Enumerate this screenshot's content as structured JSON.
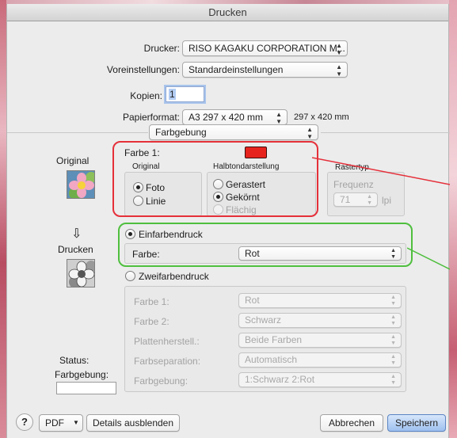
{
  "window": {
    "title": "Drucken"
  },
  "printer": {
    "label": "Drucker:",
    "value": "RISO KAGAKU CORPORATION M..."
  },
  "presets": {
    "label": "Voreinstellungen:",
    "value": "Standardeinstellungen"
  },
  "copies": {
    "label": "Kopien:",
    "value": "1"
  },
  "paper": {
    "label": "Papierformat:",
    "value": "A3 297 x 420 mm",
    "size_text": "297 x 420 mm"
  },
  "section": {
    "value": "Farbgebung"
  },
  "original": {
    "heading": "Original",
    "color1_label": "Farbe 1:",
    "color1_swatch": "#e6241d",
    "group_label": "Original",
    "options": [
      "Foto",
      "Linie"
    ],
    "selected": "Foto"
  },
  "halftone": {
    "label": "Halbtondarstellung",
    "options": [
      "Gerastert",
      "Gekörnt",
      "Flächig"
    ],
    "selected": "Gekörnt"
  },
  "raster": {
    "label": "Rastertyp",
    "frequency_label": "Frequenz",
    "value": "71",
    "unit": "lpi"
  },
  "print": {
    "heading": "Drucken",
    "single": {
      "label": "Einfarbendruck",
      "color_label": "Farbe:",
      "color_value": "Rot"
    },
    "dual": {
      "label": "Zweifarbendruck",
      "rows": [
        {
          "label": "Farbe 1:",
          "value": "Rot"
        },
        {
          "label": "Farbe 2:",
          "value": "Schwarz"
        },
        {
          "label": "Plattenherstell.:",
          "value": "Beide Farben"
        },
        {
          "label": "Farbseparation:",
          "value": "Automatisch"
        },
        {
          "label": "Farbgebung:",
          "value": "1:Schwarz 2:Rot"
        }
      ]
    }
  },
  "status": {
    "label": "Status:",
    "sublabel": "Farbgebung:"
  },
  "footer": {
    "help": "?",
    "pdf": "PDF",
    "details": "Details ausblenden",
    "cancel": "Abbrechen",
    "save": "Speichern"
  },
  "colors": {
    "annotation_red": "#e5303a",
    "annotation_green": "#4fbf3e",
    "default_button": "#9ec0ef"
  }
}
